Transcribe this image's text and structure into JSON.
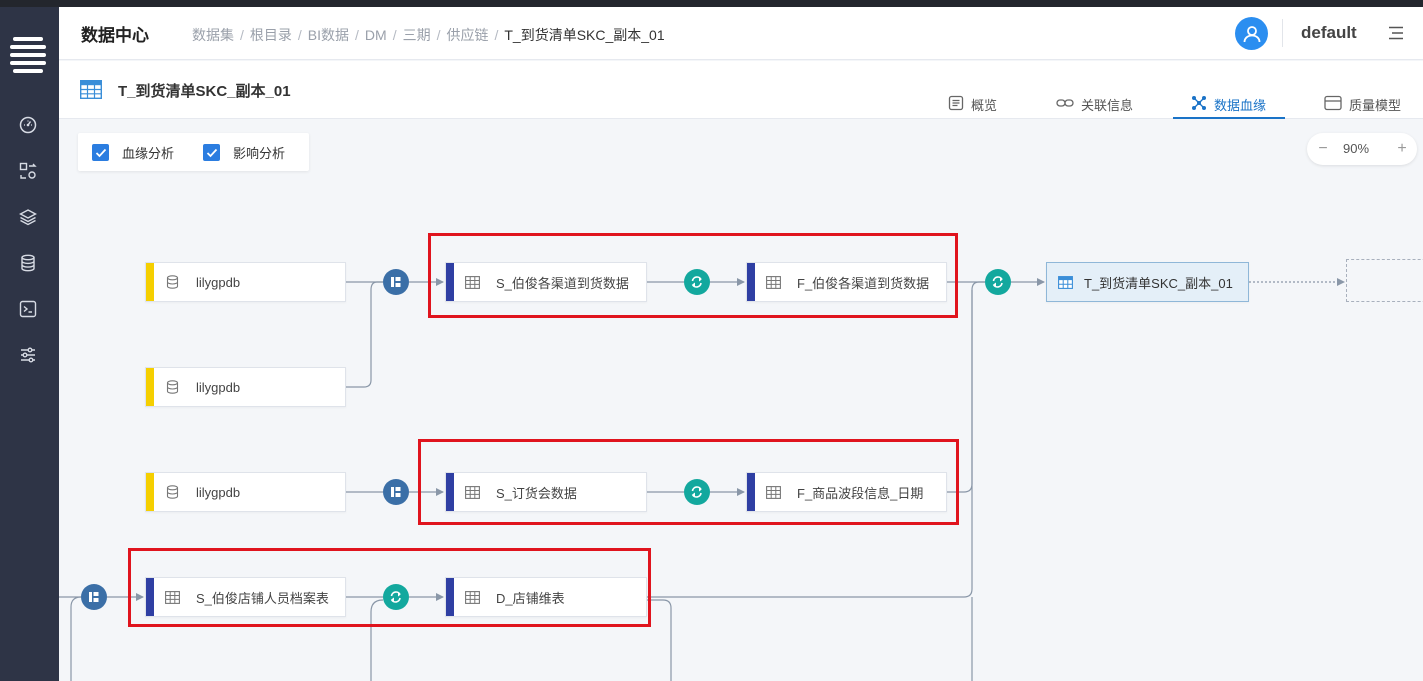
{
  "header": {
    "app_title": "数据中心",
    "breadcrumb": [
      "数据集",
      "根目录",
      "BI数据",
      "DM",
      "三期",
      "供应链",
      "T_到货清单SKC_副本_01"
    ],
    "username": "default"
  },
  "sidebar": {
    "items": [
      {
        "icon": "dashboard-icon"
      },
      {
        "icon": "transfer-icon"
      },
      {
        "icon": "layers-icon"
      },
      {
        "icon": "database-icon"
      },
      {
        "icon": "terminal-icon"
      },
      {
        "icon": "settings-sliders-icon"
      }
    ]
  },
  "page": {
    "title": "T_到货清单SKC_副本_01",
    "tabs": [
      {
        "label": "概览",
        "icon": "document-icon",
        "active": false
      },
      {
        "label": "关联信息",
        "icon": "link-icon",
        "active": false
      },
      {
        "label": "数据血缘",
        "icon": "lineage-icon",
        "active": true
      },
      {
        "label": "质量模型",
        "icon": "quality-icon",
        "active": false
      }
    ]
  },
  "toolbar": {
    "checkbox_lineage": "血缘分析",
    "checkbox_impact": "影响分析",
    "lineage_checked": true,
    "impact_checked": true,
    "zoom": "90%",
    "zoom_minus": "−",
    "zoom_plus": "+"
  },
  "graph": {
    "nodes": {
      "src1": {
        "label": "lilygpdb",
        "kind": "database"
      },
      "src2": {
        "label": "lilygpdb",
        "kind": "database"
      },
      "src3": {
        "label": "lilygpdb",
        "kind": "database"
      },
      "s_channel": {
        "label": "S_伯俊各渠道到货数据",
        "kind": "table"
      },
      "f_channel": {
        "label": "F_伯俊各渠道到货数据",
        "kind": "table"
      },
      "target": {
        "label": "T_到货清单SKC_副本_01",
        "kind": "table"
      },
      "s_order": {
        "label": "S_订货会数据",
        "kind": "table"
      },
      "f_wave": {
        "label": "F_商品波段信息_日期",
        "kind": "table"
      },
      "s_staff": {
        "label": "S_伯俊店铺人员档案表",
        "kind": "table"
      },
      "d_store": {
        "label": "D_店铺维表",
        "kind": "table"
      }
    },
    "colors": {
      "source_bar": "#f5cf00",
      "table_bar": "#2f3fa3",
      "branch_op": "#3b6fa7",
      "transform_op": "#13a89e",
      "highlight": "#e0141e"
    }
  }
}
